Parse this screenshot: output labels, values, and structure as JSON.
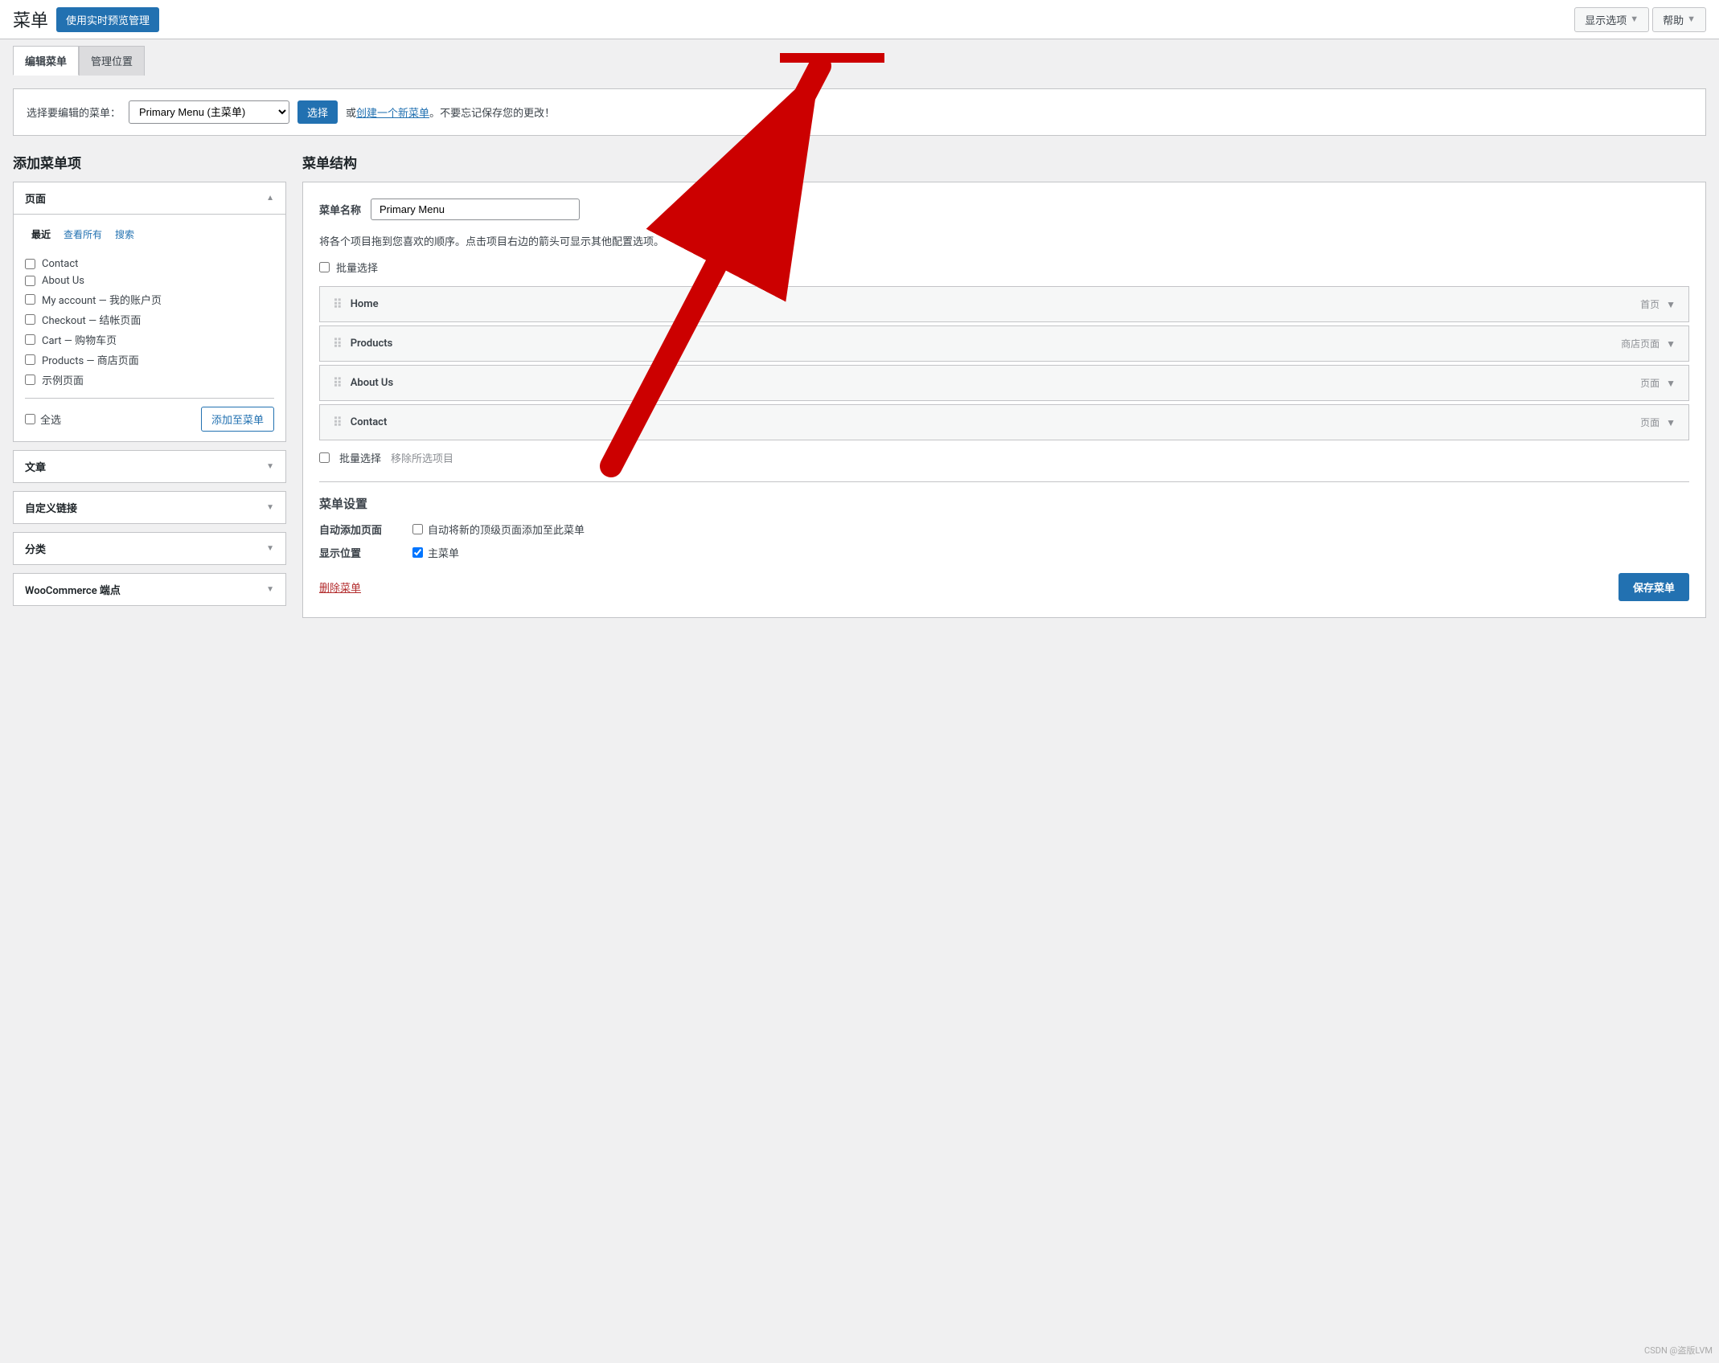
{
  "topBar": {
    "title": "菜单",
    "previewBtn": "使用实时预览管理",
    "screenOptionsBtn": "显示选项",
    "helpBtn": "帮助"
  },
  "tabs": [
    {
      "label": "编辑菜单",
      "active": true
    },
    {
      "label": "管理位置",
      "active": false
    }
  ],
  "selectBar": {
    "label": "选择要编辑的菜单：",
    "selectedMenu": "Primary Menu (主菜单)",
    "selectBtn": "选择",
    "createLink": "创建一个新菜单",
    "reminder": "。不要忘记保存您的更改！"
  },
  "leftPanel": {
    "title": "添加菜单项",
    "pages": {
      "header": "页面",
      "tabs": [
        "最近",
        "查看所有",
        "搜索"
      ],
      "activeTab": "最近",
      "items": [
        "Contact",
        "About Us",
        "My account — 我的账户页",
        "Checkout — 结帐页面",
        "Cart — 购物车页",
        "Products — 商店页面",
        "示例页面"
      ],
      "selectAllLabel": "全选",
      "addBtn": "添加至菜单"
    },
    "articles": {
      "header": "文章"
    },
    "customLink": {
      "header": "自定义链接"
    },
    "category": {
      "header": "分类"
    },
    "woocommerce": {
      "header": "WooCommerce 端点"
    }
  },
  "rightPanel": {
    "title": "菜单结构",
    "menuNameLabel": "菜单名称",
    "menuNameValue": "Primary Menu",
    "instruction": "将各个项目拖到您喜欢的顺序。点击项目右边的箭头可显示其他配置选项。",
    "batchSelectLabel": "批量选择",
    "menuItems": [
      {
        "name": "Home",
        "type": "首页"
      },
      {
        "name": "Products",
        "type": "商店页面"
      },
      {
        "name": "About Us",
        "type": "页面"
      },
      {
        "name": "Contact",
        "type": "页面"
      }
    ],
    "removeLabel": "移除所选项目",
    "settings": {
      "title": "菜单设置",
      "autoAddLabel": "自动添加页面",
      "autoAddText": "自动将新的顶级页面添加至此菜单",
      "displayLabel": "显示位置",
      "displayValue": "主菜单",
      "displayChecked": true
    },
    "deleteBtn": "删除菜单",
    "saveBtn": "保存菜单"
  }
}
